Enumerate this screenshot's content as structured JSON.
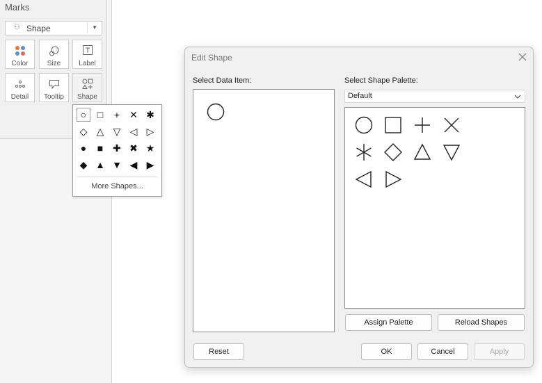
{
  "marks": {
    "title": "Marks",
    "mark_type": "Shape",
    "buttons": [
      {
        "id": "color",
        "label": "Color",
        "icon": "color-dots-icon"
      },
      {
        "id": "size",
        "label": "Size",
        "icon": "size-icon"
      },
      {
        "id": "label",
        "label": "Label",
        "icon": "label-t-icon"
      },
      {
        "id": "detail",
        "label": "Detail",
        "icon": "detail-dots-icon"
      },
      {
        "id": "tooltip",
        "label": "Tooltip",
        "icon": "tooltip-icon"
      },
      {
        "id": "shape",
        "label": "Shape",
        "icon": "shape-icon"
      }
    ],
    "color_dots": [
      "#e0793a",
      "#5b8fc9",
      "#5b8fc9",
      "#e06a6a"
    ]
  },
  "shape_popup": {
    "shapes": [
      "○",
      "□",
      "+",
      "✕",
      "✱",
      "◇",
      "△",
      "▽",
      "◁",
      "▷",
      "●",
      "■",
      "✚",
      "✖",
      "★",
      "◆",
      "▲",
      "▼",
      "◀",
      "▶"
    ],
    "selected_index": 0,
    "more_label": "More Shapes..."
  },
  "dialog": {
    "title": "Edit Shape",
    "select_data_item_label": "Select Data Item:",
    "select_palette_label": "Select Shape Palette:",
    "palette_value": "Default",
    "data_item_shape": "circle",
    "palette_shapes": [
      "circle",
      "square",
      "plus",
      "cross",
      "asterisk",
      "diamond",
      "triangle-up",
      "triangle-down",
      "triangle-left",
      "triangle-right"
    ],
    "assign_palette_label": "Assign Palette",
    "reload_shapes_label": "Reload Shapes",
    "reset_label": "Reset",
    "ok_label": "OK",
    "cancel_label": "Cancel",
    "apply_label": "Apply"
  }
}
